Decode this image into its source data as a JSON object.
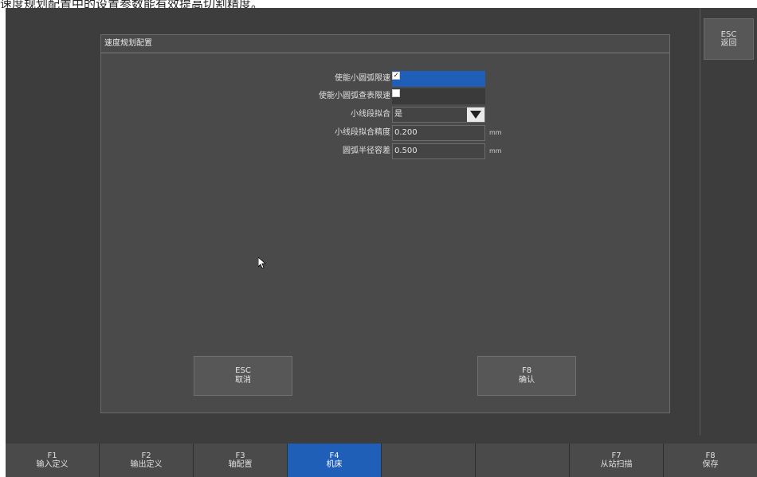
{
  "caption": "速度规划配置中的设置参数能有效提高切割精度。",
  "right_panel": {
    "esc_key": "ESC",
    "esc_label": "返回"
  },
  "dialog": {
    "title": "速度规划配置",
    "fields": [
      {
        "label": "使能小圆弧限速",
        "type": "checkbox",
        "checked": true
      },
      {
        "label": "使能小圆弧查表限速",
        "type": "checkbox",
        "checked": false
      },
      {
        "label": "小线段拟合",
        "type": "dropdown",
        "value": "是"
      },
      {
        "label": "小线段拟合精度",
        "type": "number",
        "value": "0.200",
        "unit": "mm"
      },
      {
        "label": "圆弧半径容差",
        "type": "number",
        "value": "0.500",
        "unit": "mm"
      }
    ],
    "cancel": {
      "key": "ESC",
      "label": "取消"
    },
    "confirm": {
      "key": "F8",
      "label": "确认"
    }
  },
  "function_keys": [
    {
      "key": "F1",
      "label": "输入定义"
    },
    {
      "key": "F2",
      "label": "输出定义"
    },
    {
      "key": "F3",
      "label": "轴配置"
    },
    {
      "key": "F4",
      "label": "机床",
      "active": true
    },
    {
      "key": "",
      "label": ""
    },
    {
      "key": "",
      "label": ""
    },
    {
      "key": "F7",
      "label": "从站扫描"
    },
    {
      "key": "F8",
      "label": "保存"
    }
  ],
  "colors": {
    "background": "#3d3d3d",
    "panel": "#4a4a4a",
    "accent": "#1f5fb8"
  }
}
